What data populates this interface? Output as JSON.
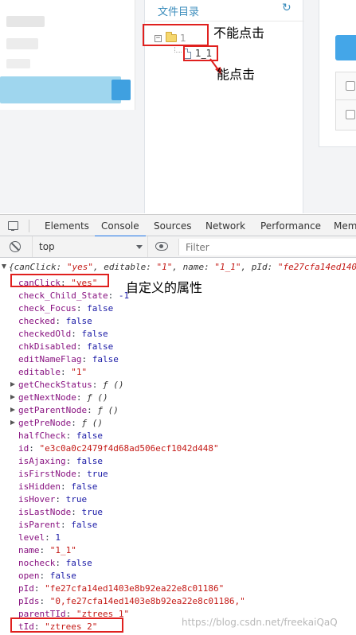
{
  "app": {
    "tree_title": "文件目录",
    "node_root": "1",
    "node_child": "1_1"
  },
  "annotations": {
    "not_clickable": "不能点击",
    "clickable": "能点击",
    "custom_attr": "自定义的属性"
  },
  "devtools": {
    "tabs": [
      "Elements",
      "Console",
      "Sources",
      "Network",
      "Performance",
      "Mem"
    ],
    "active_tab": "Console",
    "context": "top",
    "filter_placeholder": "Filter"
  },
  "console": {
    "summary": {
      "open": "{",
      "k1": "canClick",
      "v1": "\"yes\"",
      "k2": "editable",
      "v2": "\"1\"",
      "k3": "name",
      "v3": "\"1_1\"",
      "k4": "pId",
      "v4": "\"fe27cfa14ed140"
    },
    "properties": [
      {
        "key": "canClick",
        "value": "\"yes\"",
        "type": "string"
      },
      {
        "key": "check_Child_State",
        "value": "-1",
        "type": "number"
      },
      {
        "key": "check_Focus",
        "value": "false",
        "type": "bool"
      },
      {
        "key": "checked",
        "value": "false",
        "type": "bool"
      },
      {
        "key": "checkedOld",
        "value": "false",
        "type": "bool"
      },
      {
        "key": "chkDisabled",
        "value": "false",
        "type": "bool"
      },
      {
        "key": "editNameFlag",
        "value": "false",
        "type": "bool"
      },
      {
        "key": "editable",
        "value": "\"1\"",
        "type": "string"
      },
      {
        "key": "getCheckStatus",
        "value": "ƒ ()",
        "type": "func"
      },
      {
        "key": "getNextNode",
        "value": "ƒ ()",
        "type": "func"
      },
      {
        "key": "getParentNode",
        "value": "ƒ ()",
        "type": "func"
      },
      {
        "key": "getPreNode",
        "value": "ƒ ()",
        "type": "func"
      },
      {
        "key": "halfCheck",
        "value": "false",
        "type": "bool"
      },
      {
        "key": "id",
        "value": "\"e3c0a0c2479f4d68ad506ecf1042d448\"",
        "type": "string"
      },
      {
        "key": "isAjaxing",
        "value": "false",
        "type": "bool"
      },
      {
        "key": "isFirstNode",
        "value": "true",
        "type": "bool"
      },
      {
        "key": "isHidden",
        "value": "false",
        "type": "bool"
      },
      {
        "key": "isHover",
        "value": "true",
        "type": "bool"
      },
      {
        "key": "isLastNode",
        "value": "true",
        "type": "bool"
      },
      {
        "key": "isParent",
        "value": "false",
        "type": "bool"
      },
      {
        "key": "level",
        "value": "1",
        "type": "number"
      },
      {
        "key": "name",
        "value": "\"1_1\"",
        "type": "string"
      },
      {
        "key": "nocheck",
        "value": "false",
        "type": "bool"
      },
      {
        "key": "open",
        "value": "false",
        "type": "bool"
      },
      {
        "key": "pId",
        "value": "\"fe27cfa14ed1403e8b92ea22e8c01186\"",
        "type": "string"
      },
      {
        "key": "pIds",
        "value": "\"0,fe27cfa14ed1403e8b92ea22e8c01186,\"",
        "type": "string"
      },
      {
        "key": "parentTId",
        "value": "\"ztrees_1\"",
        "type": "string"
      },
      {
        "key": "tId",
        "value": "\"ztrees_2\"",
        "type": "string"
      }
    ]
  },
  "watermark": "https://blog.csdn.net/freekaiQaQ",
  "colors": {
    "annotation_red": "#e0201e",
    "string": "#c41a16",
    "key": "#881280",
    "boolean": "#1a1aa6",
    "accent": "#1a73e8"
  }
}
